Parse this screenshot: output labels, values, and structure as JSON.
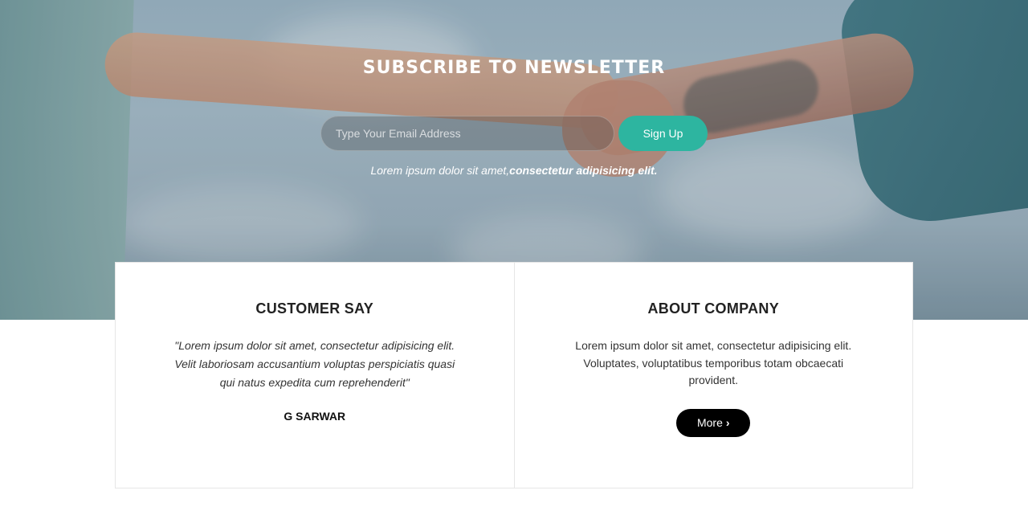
{
  "newsletter": {
    "title": "SUBSCRIBE TO NEWSLETTER",
    "email_placeholder": "Type Your Email Address",
    "signup_label": "Sign Up",
    "tagline_plain": "Lorem ipsum dolor sit amet,",
    "tagline_bold": "consectetur adipisicing elit."
  },
  "customer": {
    "heading": "CUSTOMER SAY",
    "quote": "\"Lorem ipsum dolor sit amet, consectetur adipisicing elit. Velit laboriosam accusantium voluptas perspiciatis quasi qui natus expedita cum reprehenderit\"",
    "author": "G SARWAR"
  },
  "about": {
    "heading": "ABOUT COMPANY",
    "text": "Lorem ipsum dolor sit amet, consectetur adipisicing elit. Voluptates, voluptatibus temporibus totam obcaecati provident.",
    "more_label": "More",
    "more_icon": "chevron-right-icon"
  },
  "colors": {
    "accent": "#2db5a0",
    "button_dark": "#000000"
  }
}
